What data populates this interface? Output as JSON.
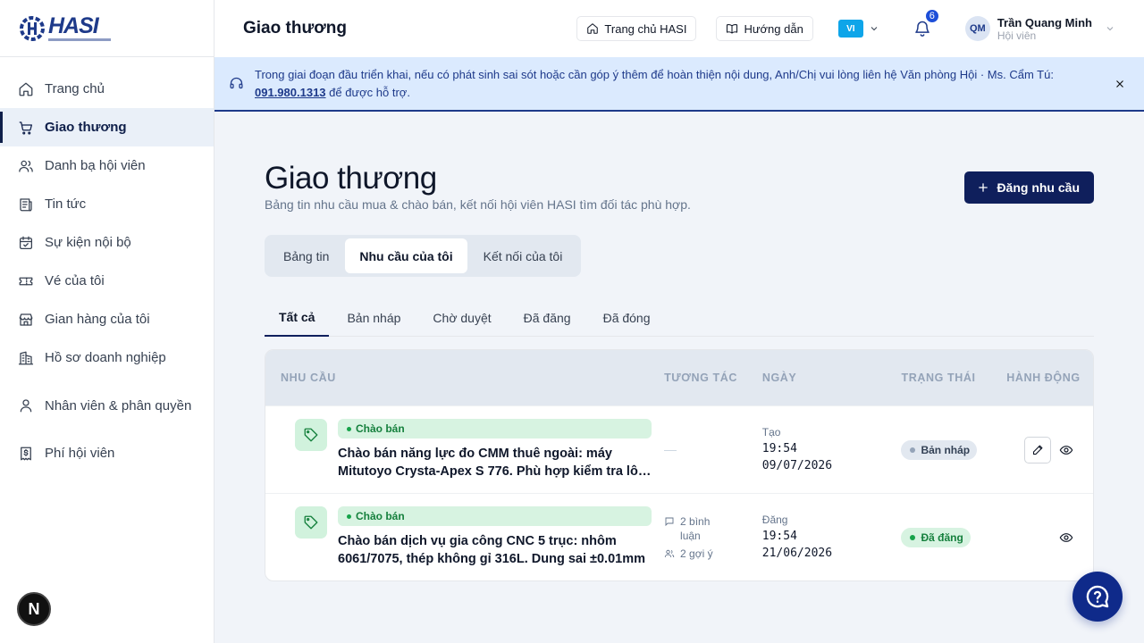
{
  "app": {
    "logo_text": "HASI"
  },
  "sidebar": {
    "items": [
      {
        "label": "Trang chủ",
        "icon": "home-icon"
      },
      {
        "label": "Giao thương",
        "icon": "cart-icon",
        "active": true
      },
      {
        "label": "Danh bạ hội viên",
        "icon": "users-icon"
      },
      {
        "label": "Tin tức",
        "icon": "newspaper-icon"
      },
      {
        "label": "Sự kiện nội bộ",
        "icon": "calendar-icon"
      },
      {
        "label": "Vé của tôi",
        "icon": "ticket-icon"
      },
      {
        "label": "Gian hàng của tôi",
        "icon": "store-icon"
      },
      {
        "label": "Hồ sơ doanh nghiệp",
        "icon": "building-icon"
      },
      {
        "label": "Nhân viên & phân quyền",
        "icon": "user-icon"
      },
      {
        "label": "Phí hội viên",
        "icon": "receipt-icon"
      }
    ],
    "n_badge": "N"
  },
  "header": {
    "title": "Giao thương",
    "home_button": "Trang chủ HASI",
    "guide_button": "Hướng dẫn",
    "language": "VI",
    "notification_count": "6",
    "user": {
      "initials": "QM",
      "name": "Trần Quang Minh",
      "role": "Hội viên"
    }
  },
  "banner": {
    "text_before": "Trong giai đoạn đầu triển khai, nếu có phát sinh sai sót hoặc cần góp ý thêm để hoàn thiện nội dung, Anh/Chị vui lòng liên hệ Văn phòng Hội · Ms. Cẩm Tú: ",
    "phone": "091.980.1313",
    "text_after": " để được hỗ trợ."
  },
  "page": {
    "title": "Giao thương",
    "subtitle": "Bảng tin nhu cầu mua & chào bán, kết nối hội viên HASI tìm đối tác phù hợp.",
    "primary_button": "Đăng nhu cầu",
    "segments": [
      "Bảng tin",
      "Nhu cầu của tôi",
      "Kết nối của tôi"
    ],
    "active_segment": 1,
    "tabs": [
      "Tất cả",
      "Bản nháp",
      "Chờ duyệt",
      "Đã đăng",
      "Đã đóng"
    ],
    "active_tab": 0
  },
  "table": {
    "headers": [
      "Nhu cầu",
      "Tương tác",
      "Ngày",
      "Trạng thái",
      "Hành động"
    ],
    "rows": [
      {
        "type": "Chào bán",
        "title": "Chào bán năng lực đo CMM thuê ngoài: máy Mitutoyo Crysta-Apex S 776. Phù hợp kiểm tra lô sản phẩm",
        "interaction_empty": "—",
        "date_label": "Tạo",
        "time": "19:54",
        "date": "09/07/2026",
        "status": "Bản nháp",
        "status_kind": "draft",
        "editable": true
      },
      {
        "type": "Chào bán",
        "title": "Chào bán dịch vụ gia công CNC 5 trục: nhôm 6061/7075, thép không gỉ 316L. Dung sai ±0.01mm",
        "comments": "2 bình luận",
        "suggestions": "2 gợi ý",
        "date_label": "Đăng",
        "time": "19:54",
        "date": "21/06/2026",
        "status": "Đã đăng",
        "status_kind": "pub",
        "editable": false
      }
    ]
  },
  "colors": {
    "primary": "#0f1f5c",
    "accent": "#1e3a8a",
    "success": "#16a34a",
    "banner_bg": "#dbeafe"
  }
}
